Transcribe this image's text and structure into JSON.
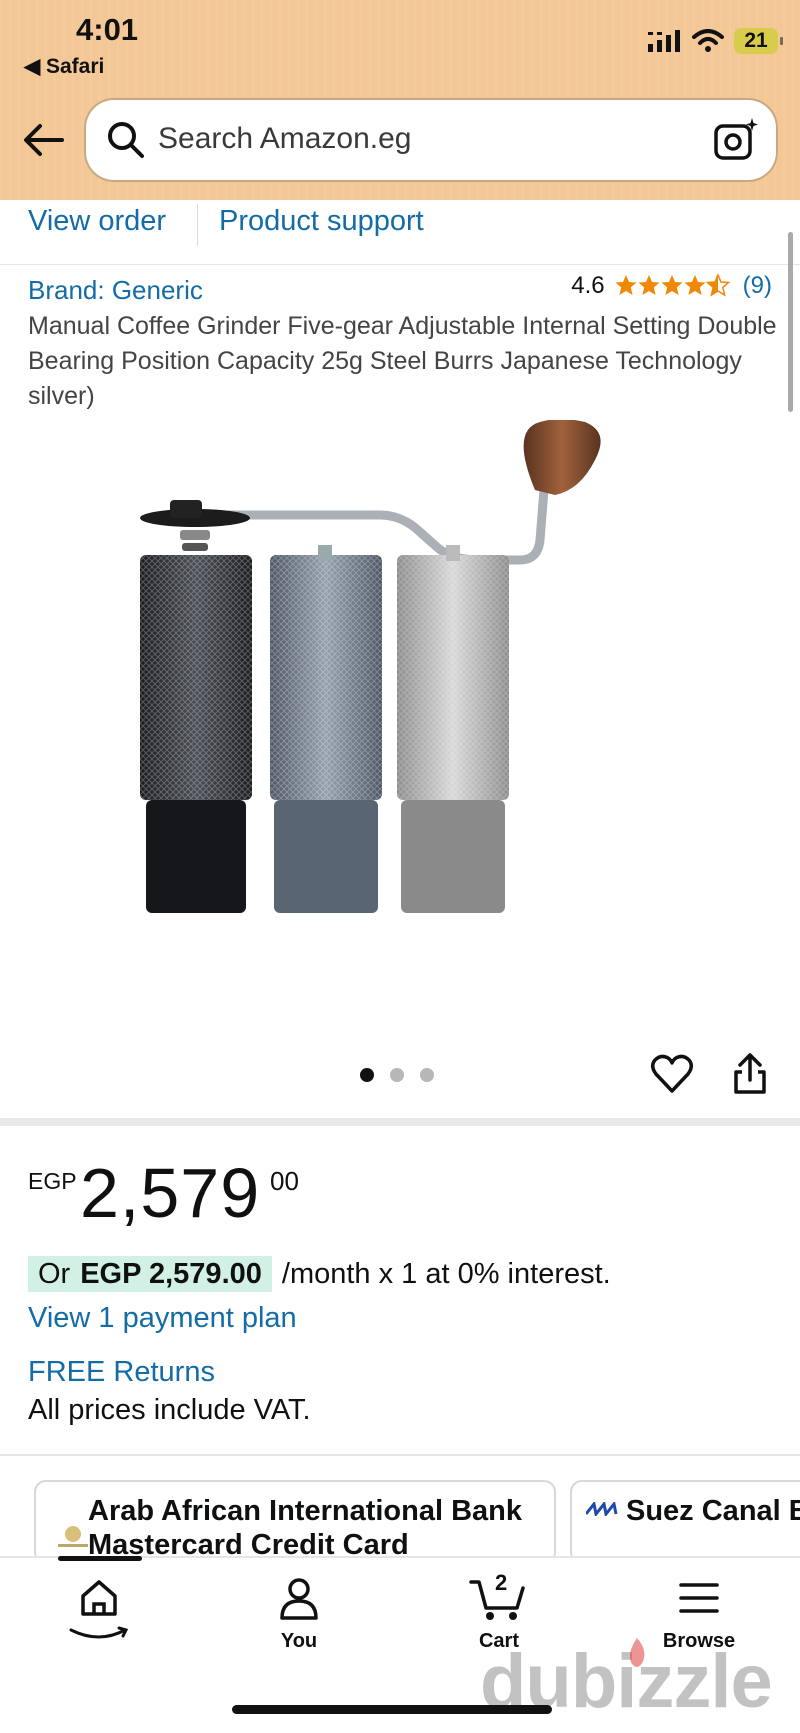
{
  "status_bar": {
    "time": "4:01",
    "back_app": "◀ Safari",
    "battery": "21"
  },
  "search": {
    "placeholder": "Search Amazon.eg"
  },
  "tabs": {
    "view_order": "View order",
    "product_support": "Product support"
  },
  "product": {
    "brand": "Brand: Generic",
    "rating": "4.6",
    "rating_stars": 4.5,
    "rating_count": "(9)",
    "title": "Manual Coffee Grinder Five-gear Adjustable Internal Setting Double Bearing Position Capacity 25g Steel Burrs Japanese Technology silver)",
    "image_count": 3,
    "image_index": 1
  },
  "price": {
    "currency": "EGP",
    "whole": "2,579",
    "fraction": "00"
  },
  "installment": {
    "prefix": "Or",
    "amount": "EGP 2,579.00",
    "suffix": "/month x 1 at 0% interest."
  },
  "links": {
    "view_plan": "View 1 payment plan",
    "free_returns": "FREE Returns"
  },
  "vat_note": "All prices include VAT.",
  "offers": [
    {
      "title": "Arab African International Bank Mastercard Credit Card"
    },
    {
      "title": "Suez Canal B"
    }
  ],
  "bottom_nav": {
    "home": "",
    "you": "You",
    "cart": "Cart",
    "cart_count": "2",
    "browse": "Browse"
  },
  "watermark": "dubizzle",
  "colors": {
    "link": "#136ca5",
    "star": "#f08804",
    "header": "#f3c896"
  }
}
